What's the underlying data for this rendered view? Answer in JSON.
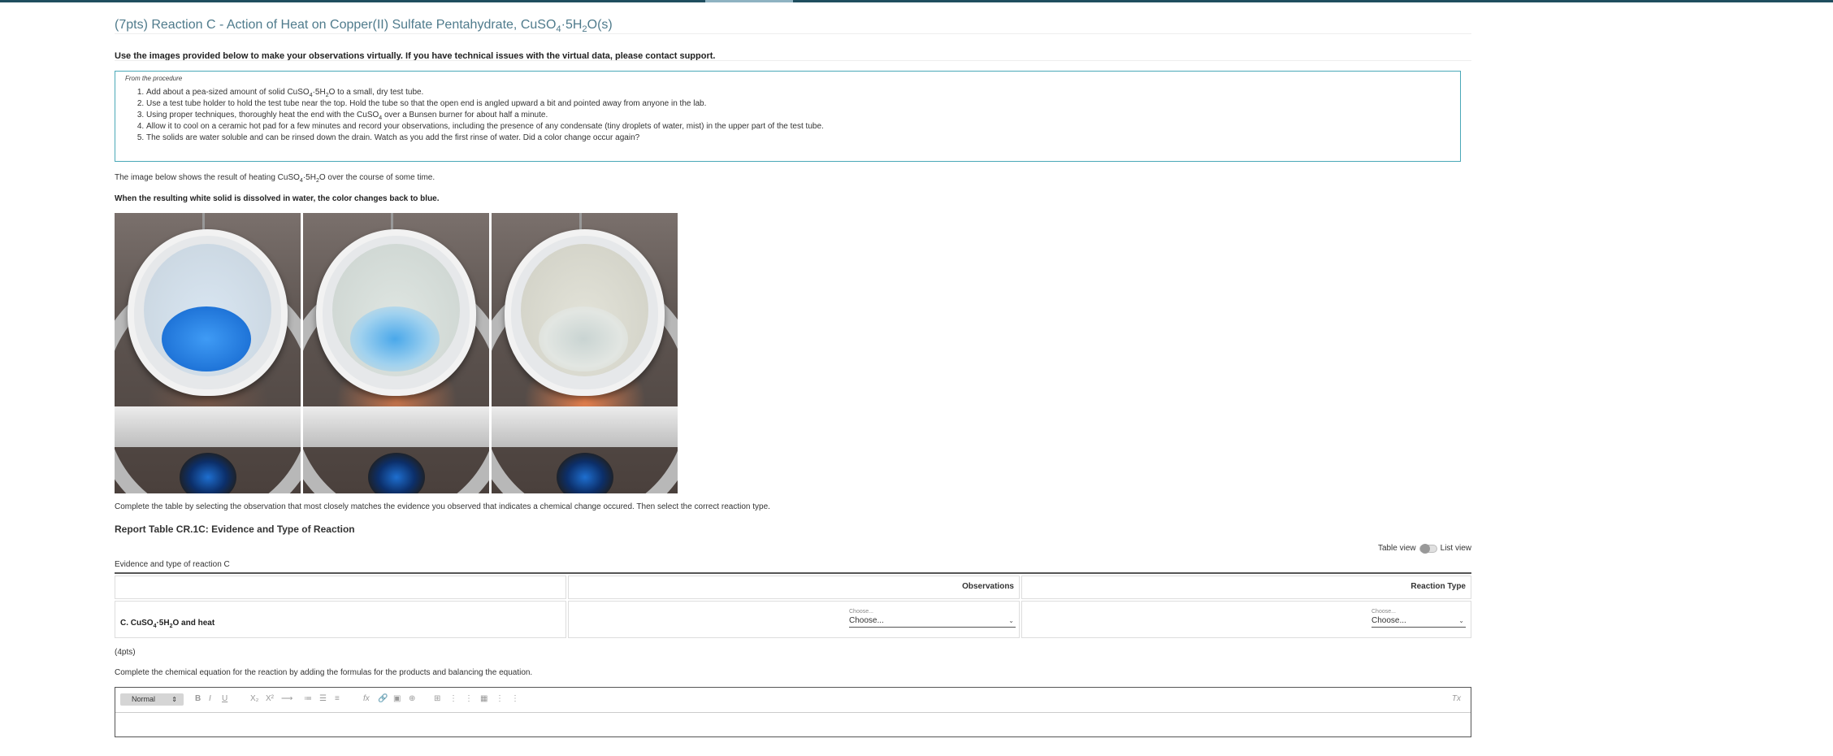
{
  "title_prefix": "(7pts) Reaction C - Action of Heat on Copper(II) Sulfate Pentahydrate, CuSO",
  "title_sub4": "4",
  "title_mid": "·5H",
  "title_sub2": "2",
  "title_end": "O(s)",
  "instruction_bold": "Use the images provided below to make your observations virtually. If you have technical issues with the virtual data, please contact support.",
  "procedure": {
    "label": "From the procedure",
    "step1_a": "Add about a pea-sized amount of solid CuSO",
    "step1_b": "·5H",
    "step1_c": "O to a small, dry test tube.",
    "step2": "Use a test tube holder to hold the test tube near the top. Hold the tube so that the open end is angled upward a bit and pointed away from anyone in the lab.",
    "step3_a": "Using proper techniques, thoroughly heat the end with the CuSO",
    "step3_b": " over a Bunsen burner for about half a minute.",
    "step4": "Allow it to cool on a ceramic hot pad for a few minutes and record your observations, including the presence of any condensate (tiny droplets of water, mist) in the upper part of the test tube.",
    "step5": "The solids are water soluble and can be rinsed down the drain. Watch as you add the first rinse of water. Did a color change occur again?",
    "sub4": "4",
    "sub2": "2"
  },
  "image_caption_a": "The image below shows the result of heating CuSO",
  "image_caption_b": "·5H",
  "image_caption_c": "O over the course of some time.",
  "dissolve_note": "When the resulting white solid is dissolved in water, the color changes back to blue.",
  "complete_table_instr": "Complete the table by selecting the observation that most closely matches the evidence you observed that indicates a chemical change occured. Then select the correct reaction type.",
  "report_title": "Report Table CR.1C: Evidence and Type of Reaction",
  "toggle": {
    "left": "Table view",
    "right": "List view"
  },
  "table": {
    "caption": "Evidence and type of reaction C",
    "col_observations": "Observations",
    "col_reaction_type": "Reaction Type",
    "row_label_a": "C. CuSO",
    "row_label_b": "·5H",
    "row_label_c": "O and heat",
    "select_hint": "Choose...",
    "select_value": "Choose..."
  },
  "points_note": "(4pts)",
  "equation_instr": "Complete the chemical equation for the reaction by adding the formulas for the products and balancing the equation.",
  "editor": {
    "format": "Normal",
    "tools": [
      "B",
      "I",
      "U",
      "X₂",
      "X²",
      "⟶",
      "≔",
      "☰",
      "≡",
      "fx",
      "🔗",
      "▣",
      "⊕",
      "⊞",
      "⋮",
      "⋮",
      "▦",
      "⋮",
      "⋮",
      "Tx"
    ]
  },
  "colors": {
    "accent": "#4aa8b8",
    "title": "#4f7b8c",
    "topbar": "#1f4e5f"
  },
  "photos": [
    {
      "stage": "blue crystals",
      "pile_color": "#2f86e8"
    },
    {
      "stage": "partially dehydrated",
      "pile_color": "#7fc0e8"
    },
    {
      "stage": "white anhydrous",
      "pile_color": "#d7dcd8"
    }
  ]
}
